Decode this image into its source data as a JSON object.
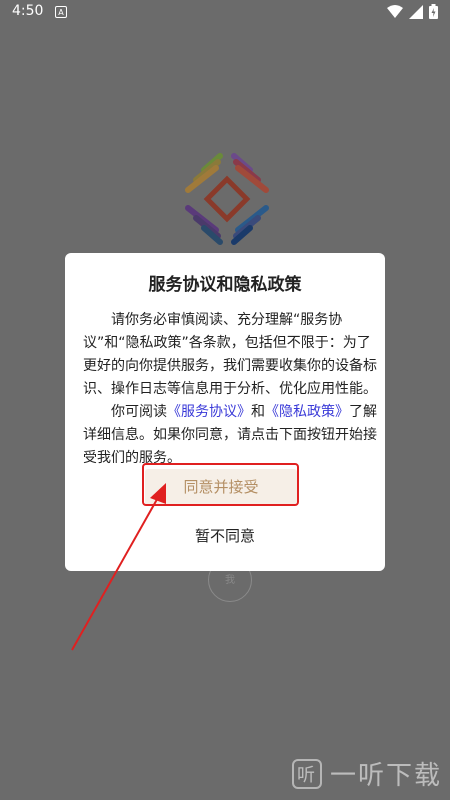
{
  "status_bar": {
    "time": "4:50",
    "notification_icon": "A"
  },
  "dialog": {
    "title": "服务协议和隐私政策",
    "para1": "请你务必审慎阅读、充分理解“服务协议”和“隐私政策”各条款，包括但不限于：为了更好的向你提供服务，我们需要收集你的设备标识、操作日志等信息用于分析、优化应用性能。",
    "para2_prefix": "你可阅读",
    "link_service": "《服务协议》",
    "para2_and": "和",
    "link_privacy": "《隐私政策》",
    "para2_suffix": "了解详细信息。如果你同意，请点击下面按钮开始接受我们的服务。",
    "accept_label": "同意并接受",
    "decline_label": "暂不同意"
  },
  "background_circle_text": "我",
  "watermark": {
    "icon_text": "听",
    "text": "一听下载"
  },
  "colors": {
    "overlay": "#6b6b6b",
    "link": "#3a3ad8",
    "accept_bg": "#f6efe7",
    "accept_text": "#b48f64",
    "annotation_red": "#e02020"
  }
}
